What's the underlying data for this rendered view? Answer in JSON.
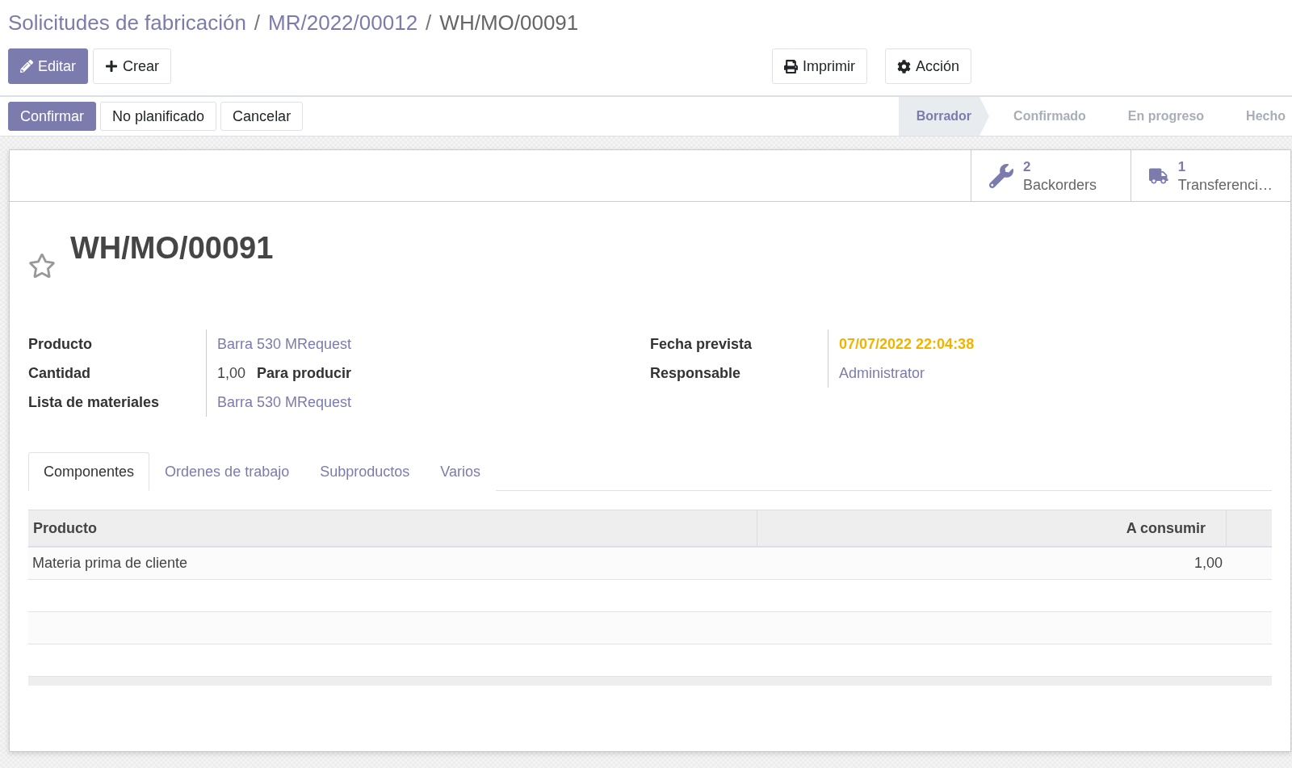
{
  "breadcrumbs": [
    {
      "label": "Solicitudes de fabricación",
      "kind": "link"
    },
    {
      "label": "MR/2022/00012",
      "kind": "link",
      "separator": "/"
    },
    {
      "label": "WH/MO/00091",
      "kind": "current",
      "separator": "/"
    }
  ],
  "control_buttons": [
    {
      "label": "Editar",
      "kind": "primary"
    },
    {
      "label": "Crear",
      "kind": "secondary"
    }
  ],
  "action_buttons": [
    {
      "label": "Imprimir"
    },
    {
      "label": "Acción"
    }
  ],
  "header_buttons": [
    {
      "label": "Confirmar",
      "kind": "primary"
    },
    {
      "label": "No planificado",
      "kind": "secondary"
    },
    {
      "label": "Cancelar",
      "kind": "secondary"
    }
  ],
  "stages": [
    {
      "label": "Borrador",
      "selected": true
    },
    {
      "label": "Confirmado",
      "selected": false
    },
    {
      "label": "En progreso",
      "selected": false
    },
    {
      "label": "Hecho",
      "selected": false
    }
  ],
  "smart_buttons": [
    {
      "count": "2",
      "label": "Backorders"
    },
    {
      "count": "1",
      "label": "Transferenci…"
    }
  ],
  "record": {
    "title": "WH/MO/00091",
    "starred": false
  },
  "left_fields": [
    {
      "label": "Producto",
      "value": "Barra 530 MRequest",
      "kind": "link"
    },
    {
      "label": "Cantidad",
      "value": "1,00",
      "unit": "Para producir",
      "kind": "quantity"
    },
    {
      "label": "Lista de materiales",
      "value": "Barra 530 MRequest",
      "kind": "link"
    }
  ],
  "right_fields": [
    {
      "label": "Fecha prevista",
      "value": "07/07/2022 22:04:38",
      "kind": "warning"
    },
    {
      "label": "Responsable",
      "value": "Administrator",
      "kind": "link"
    }
  ],
  "tabs": [
    {
      "label": "Componentes",
      "selected": true
    },
    {
      "label": "Ordenes de trabajo",
      "selected": false
    },
    {
      "label": "Subproductos",
      "selected": false
    },
    {
      "label": "Varios",
      "selected": false
    }
  ],
  "table": {
    "columns": [
      "Producto",
      "A consumir"
    ],
    "rows": [
      {
        "cells": [
          "Materia prima de cliente",
          "1,00"
        ]
      }
    ]
  }
}
